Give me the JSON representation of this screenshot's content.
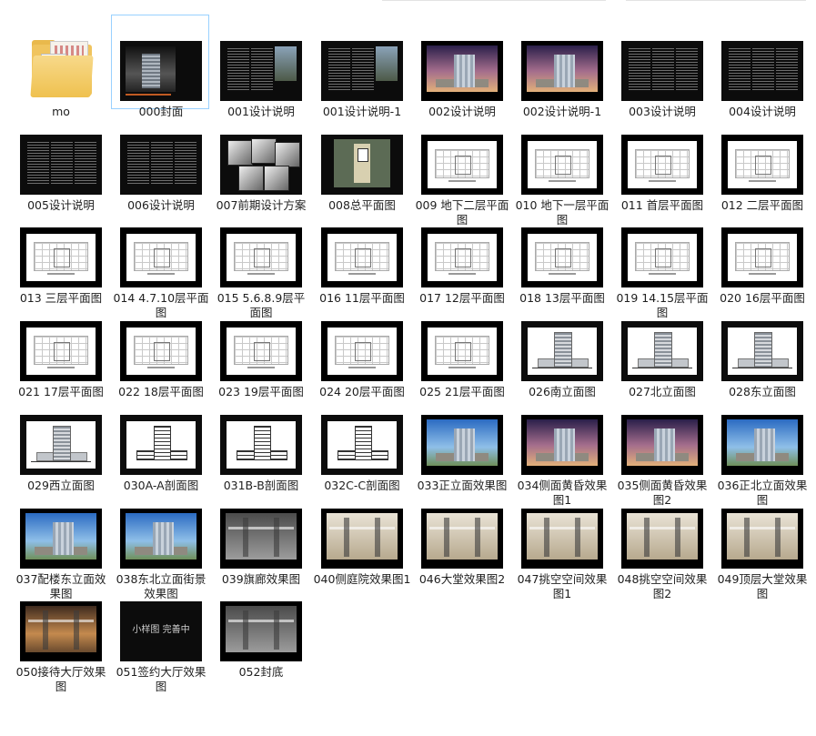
{
  "window": {
    "title": ""
  },
  "items": [
    {
      "label": "mo",
      "kind": "folder",
      "selected": false
    },
    {
      "label": "000封面",
      "kind": "cover",
      "selected": true
    },
    {
      "label": "001设计说明",
      "kind": "text-img"
    },
    {
      "label": "001设计说明-1",
      "kind": "text-img"
    },
    {
      "label": "002设计说明",
      "kind": "render-sunset"
    },
    {
      "label": "002设计说明-1",
      "kind": "render-sunset"
    },
    {
      "label": "003设计说明",
      "kind": "text"
    },
    {
      "label": "004设计说明",
      "kind": "text"
    },
    {
      "label": "005设计说明",
      "kind": "text"
    },
    {
      "label": "006设计说明",
      "kind": "text"
    },
    {
      "label": "007前期设计方案",
      "kind": "concept"
    },
    {
      "label": "008总平面图",
      "kind": "site"
    },
    {
      "label": "009 地下二层平面图",
      "kind": "plan"
    },
    {
      "label": "010 地下一层平面图",
      "kind": "plan"
    },
    {
      "label": "011 首层平面图",
      "kind": "plan"
    },
    {
      "label": "012 二层平面图",
      "kind": "plan"
    },
    {
      "label": "013 三层平面图",
      "kind": "plan"
    },
    {
      "label": "014 4.7.10层平面图",
      "kind": "plan"
    },
    {
      "label": "015 5.6.8.9层平面图",
      "kind": "plan"
    },
    {
      "label": "016 11层平面图",
      "kind": "plan"
    },
    {
      "label": "017 12层平面图",
      "kind": "plan"
    },
    {
      "label": "018 13层平面图",
      "kind": "plan"
    },
    {
      "label": "019 14.15层平面图",
      "kind": "plan"
    },
    {
      "label": "020 16层平面图",
      "kind": "plan"
    },
    {
      "label": "021 17层平面图",
      "kind": "plan"
    },
    {
      "label": "022 18层平面图",
      "kind": "plan"
    },
    {
      "label": "023 19层平面图",
      "kind": "plan"
    },
    {
      "label": "024 20层平面图",
      "kind": "plan"
    },
    {
      "label": "025 21层平面图",
      "kind": "plan"
    },
    {
      "label": "026南立面图",
      "kind": "elev"
    },
    {
      "label": "027北立面图",
      "kind": "elev"
    },
    {
      "label": "028东立面图",
      "kind": "elev"
    },
    {
      "label": "029西立面图",
      "kind": "elev"
    },
    {
      "label": "030A-A剖面图",
      "kind": "section"
    },
    {
      "label": "031B-B剖面图",
      "kind": "section"
    },
    {
      "label": "032C-C剖面图",
      "kind": "section"
    },
    {
      "label": "033正立面效果图",
      "kind": "render-day"
    },
    {
      "label": "034侧面黄昏效果图1",
      "kind": "render-sunset"
    },
    {
      "label": "035侧面黄昏效果图2",
      "kind": "render-sunset"
    },
    {
      "label": "036正北立面效果图",
      "kind": "render-day"
    },
    {
      "label": "037配楼东立面效果图",
      "kind": "render-day"
    },
    {
      "label": "038东北立面街景效果图",
      "kind": "render-day"
    },
    {
      "label": "039旗廊效果图",
      "kind": "interior-dark"
    },
    {
      "label": "040侧庭院效果图1",
      "kind": "interior"
    },
    {
      "label": "046大堂效果图2",
      "kind": "interior"
    },
    {
      "label": "047挑空空间效果图1",
      "kind": "interior"
    },
    {
      "label": "048挑空空间效果图2",
      "kind": "interior"
    },
    {
      "label": "049顶层大堂效果图",
      "kind": "interior"
    },
    {
      "label": "050接待大厅效果图",
      "kind": "interior-warm"
    },
    {
      "label": "051签约大厅效果图",
      "kind": "black-text",
      "thumb_text": "小样图 完善中"
    },
    {
      "label": "052封底",
      "kind": "interior-dark"
    }
  ]
}
